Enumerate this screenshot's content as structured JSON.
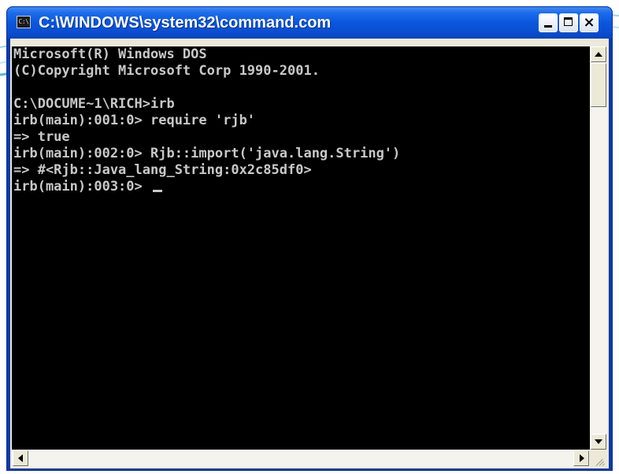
{
  "window": {
    "title": "C:\\WINDOWS\\system32\\command.com",
    "icon_label": "C:\\",
    "icon": "console-icon",
    "close_glyph": "×"
  },
  "console": {
    "lines": [
      "Microsoft(R) Windows DOS",
      "(C)Copyright Microsoft Corp 1990-2001.",
      "",
      "C:\\DOCUME~1\\RICH>irb",
      "irb(main):001:0> require 'rjb'",
      "=> true",
      "irb(main):002:0> Rjb::import('java.lang.String')",
      "=> #<Rjb::Java_lang_String:0x2c85df0>",
      "irb(main):003:0> "
    ]
  },
  "colors": {
    "titlebar": "#0a56dd",
    "console_bg": "#000000",
    "console_text": "#c8c8c8"
  }
}
